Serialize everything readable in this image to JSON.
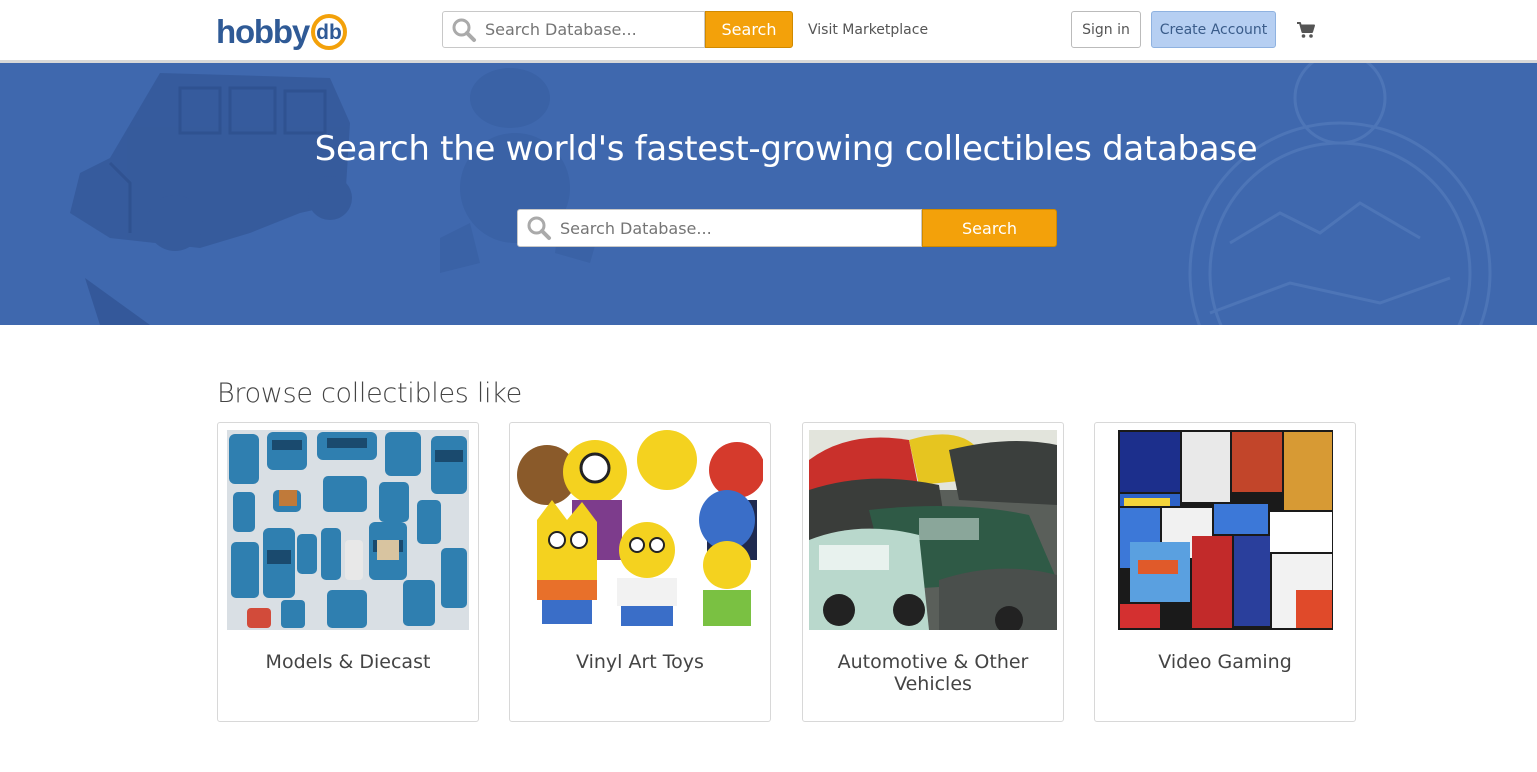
{
  "header": {
    "logo_text": "hobby",
    "logo_badge": "db",
    "search_placeholder": "Search Database...",
    "search_button": "Search",
    "marketplace_link": "Visit Marketplace",
    "sign_in": "Sign in",
    "create_account": "Create Account",
    "cart_icon": "shopping-cart-icon"
  },
  "hero": {
    "title": "Search the world's fastest-growing collectibles database",
    "search_placeholder": "Search Database...",
    "search_button": "Search"
  },
  "browse": {
    "title": "Browse collectibles like",
    "categories": [
      {
        "label": "Models & Diecast"
      },
      {
        "label": "Vinyl Art Toys"
      },
      {
        "label": "Automotive & Other Vehicles"
      },
      {
        "label": "Video Gaming"
      }
    ]
  },
  "colors": {
    "brand_blue": "#2f5a96",
    "hero_blue": "#3f68ae",
    "accent_orange": "#f3a10a",
    "create_account_bg": "#b6cff2"
  }
}
